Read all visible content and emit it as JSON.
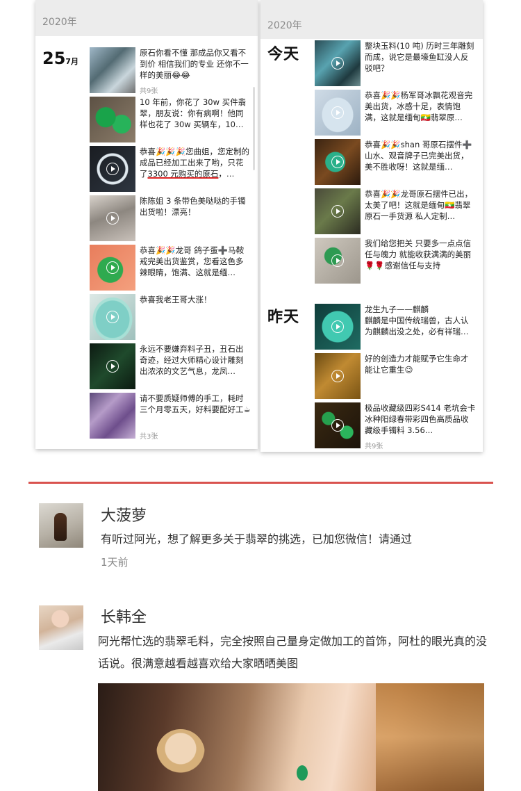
{
  "left_screenshot": {
    "year": "2020年",
    "date_day": "25",
    "date_month": "7月",
    "posts": [
      {
        "text": "原石你看不懂 那成品你又看不到价 相信我们的专业 还你不一样的美丽😂😂",
        "count": "共9张",
        "thumb": "g1",
        "video": false
      },
      {
        "text": "10 年前，你花了 30w 买件翡翠，朋友说：你有病啊！他同样也花了 30w 买辆车，10…",
        "thumb": "g2",
        "video": false
      },
      {
        "text_pre": "恭喜🎉🎉🎉您曲姐，您定制的成品已经加工出来了哟，只花了",
        "text_underlined": "3300 元购买的原石",
        "text_post": "，…",
        "thumb": "g3",
        "video": true
      },
      {
        "text": "陈陈姐 3 条带色美哒哒的手镯出货啦！漂亮！",
        "thumb": "g4",
        "video": true
      },
      {
        "text": "恭喜🎉🎉龙哥 鸽子蛋➕马鞍戒完美出货鉴赏，您看这色多辣眼睛，饱满、这就是缅…",
        "thumb": "g5",
        "video": true
      },
      {
        "text": "恭喜我老王哥大涨！",
        "thumb": "g6",
        "video": true
      },
      {
        "text": "永远不要嫌弃料子丑，丑石出奇迹，经过大师精心设计雕刻出浓浓的文艺气息，龙凤…",
        "thumb": "g7",
        "video": true
      },
      {
        "text": "请不要质疑师傅的手工，耗时三个月零五天，好料要配好工☕",
        "count": "共3张",
        "thumb": "g8",
        "video": false
      }
    ]
  },
  "right_screenshot": {
    "year": "2020年",
    "today_label": "今天",
    "yesterday_label": "昨天",
    "posts": [
      {
        "text": "整块玉料(10 吨) 历时三年雕刻而成，说它是最壕鱼缸没人反驳吧？",
        "thumb": "r1",
        "video": true
      },
      {
        "text": "恭喜🎉🎉杨军哥冰飘花观音完美出货，冰感十足，表情饱满，这就是缅甸🇲🇲翡翠原…",
        "thumb": "r2",
        "video": true
      },
      {
        "text": "恭喜🎉🎉shan 哥原石摆件➕山水、观音牌子已完美出货，美不胜收呀！这就是缅…",
        "thumb": "r3",
        "video": true
      },
      {
        "text": "恭喜🎉🎉龙哥原石摆件已出，太美了吧！这就是缅甸🇲🇲翡翠原石一手货源 私人定制…",
        "thumb": "r4",
        "video": true
      },
      {
        "text": "我们给您把关 只要多一点点信任与魄力 就能收获满满的美丽🌹🌹感谢信任与支持",
        "thumb": "r5",
        "video": true
      },
      {
        "text": "龙生九子——麒麟\n麒麟是中国传统瑞兽，古人认为麒麟出没之处，必有祥瑞…",
        "thumb": "r6",
        "video": true
      },
      {
        "text": "好的创造力才能赋予它生命才能让它重生😉",
        "thumb": "r7",
        "video": true
      },
      {
        "text": "极品收藏级四彩S414 老坑会卡冰种阳绿春带彩四色高质品收藏级手镯料 3.56…",
        "count": "共9张",
        "thumb": "r8",
        "video": true
      }
    ]
  },
  "comments": [
    {
      "name": "大菠萝",
      "text": "有听过阿光，想了解更多关于翡翠的挑选，已加您微信！请通过",
      "time": "1天前"
    },
    {
      "name": "长韩全",
      "text": "阿光帮忙选的翡翠毛料，完全按照自己量身定做加工的首饰，阿杜的眼光真的没话说。很满意越看越喜欢给大家晒晒美图"
    }
  ],
  "colors": {
    "divider": "#d9534f",
    "year_bar": "#ececec",
    "underline": "#dd2222"
  }
}
